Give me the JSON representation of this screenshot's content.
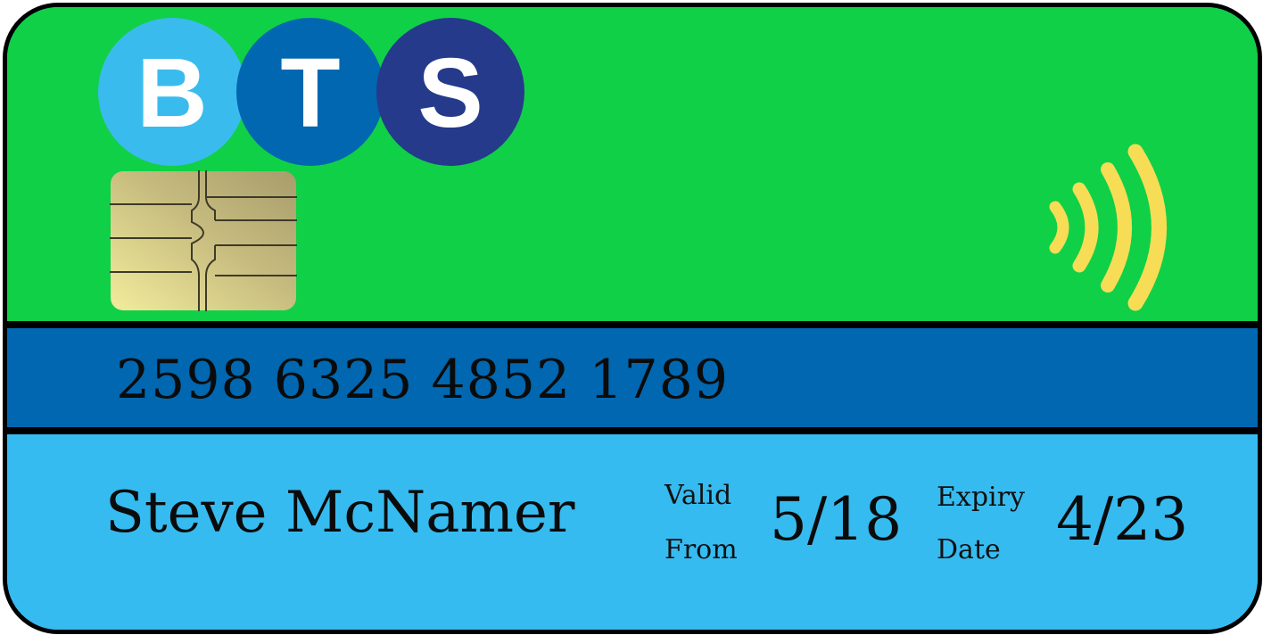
{
  "card": {
    "logo": {
      "letters": [
        "B",
        "T",
        "S"
      ],
      "text": "BTS"
    },
    "colors": {
      "top_band": "#10d047",
      "middle_band": "#0067b0",
      "bottom_band": "#36bbf0",
      "logo_b": "#3abbee",
      "logo_t": "#0067b0",
      "logo_s": "#253a8b",
      "nfc_waves": "#f6dd55"
    },
    "icons": {
      "chip": "emv-chip-icon",
      "contactless": "contactless-icon"
    },
    "number": "2598 6325 4852 1789",
    "holder_name": "Steve McNamer",
    "valid_from": {
      "label_line1": "Valid",
      "label_line2": "From",
      "value": "5/18"
    },
    "expiry": {
      "label_line1": "Expiry",
      "label_line2": "Date",
      "value": "4/23"
    }
  }
}
